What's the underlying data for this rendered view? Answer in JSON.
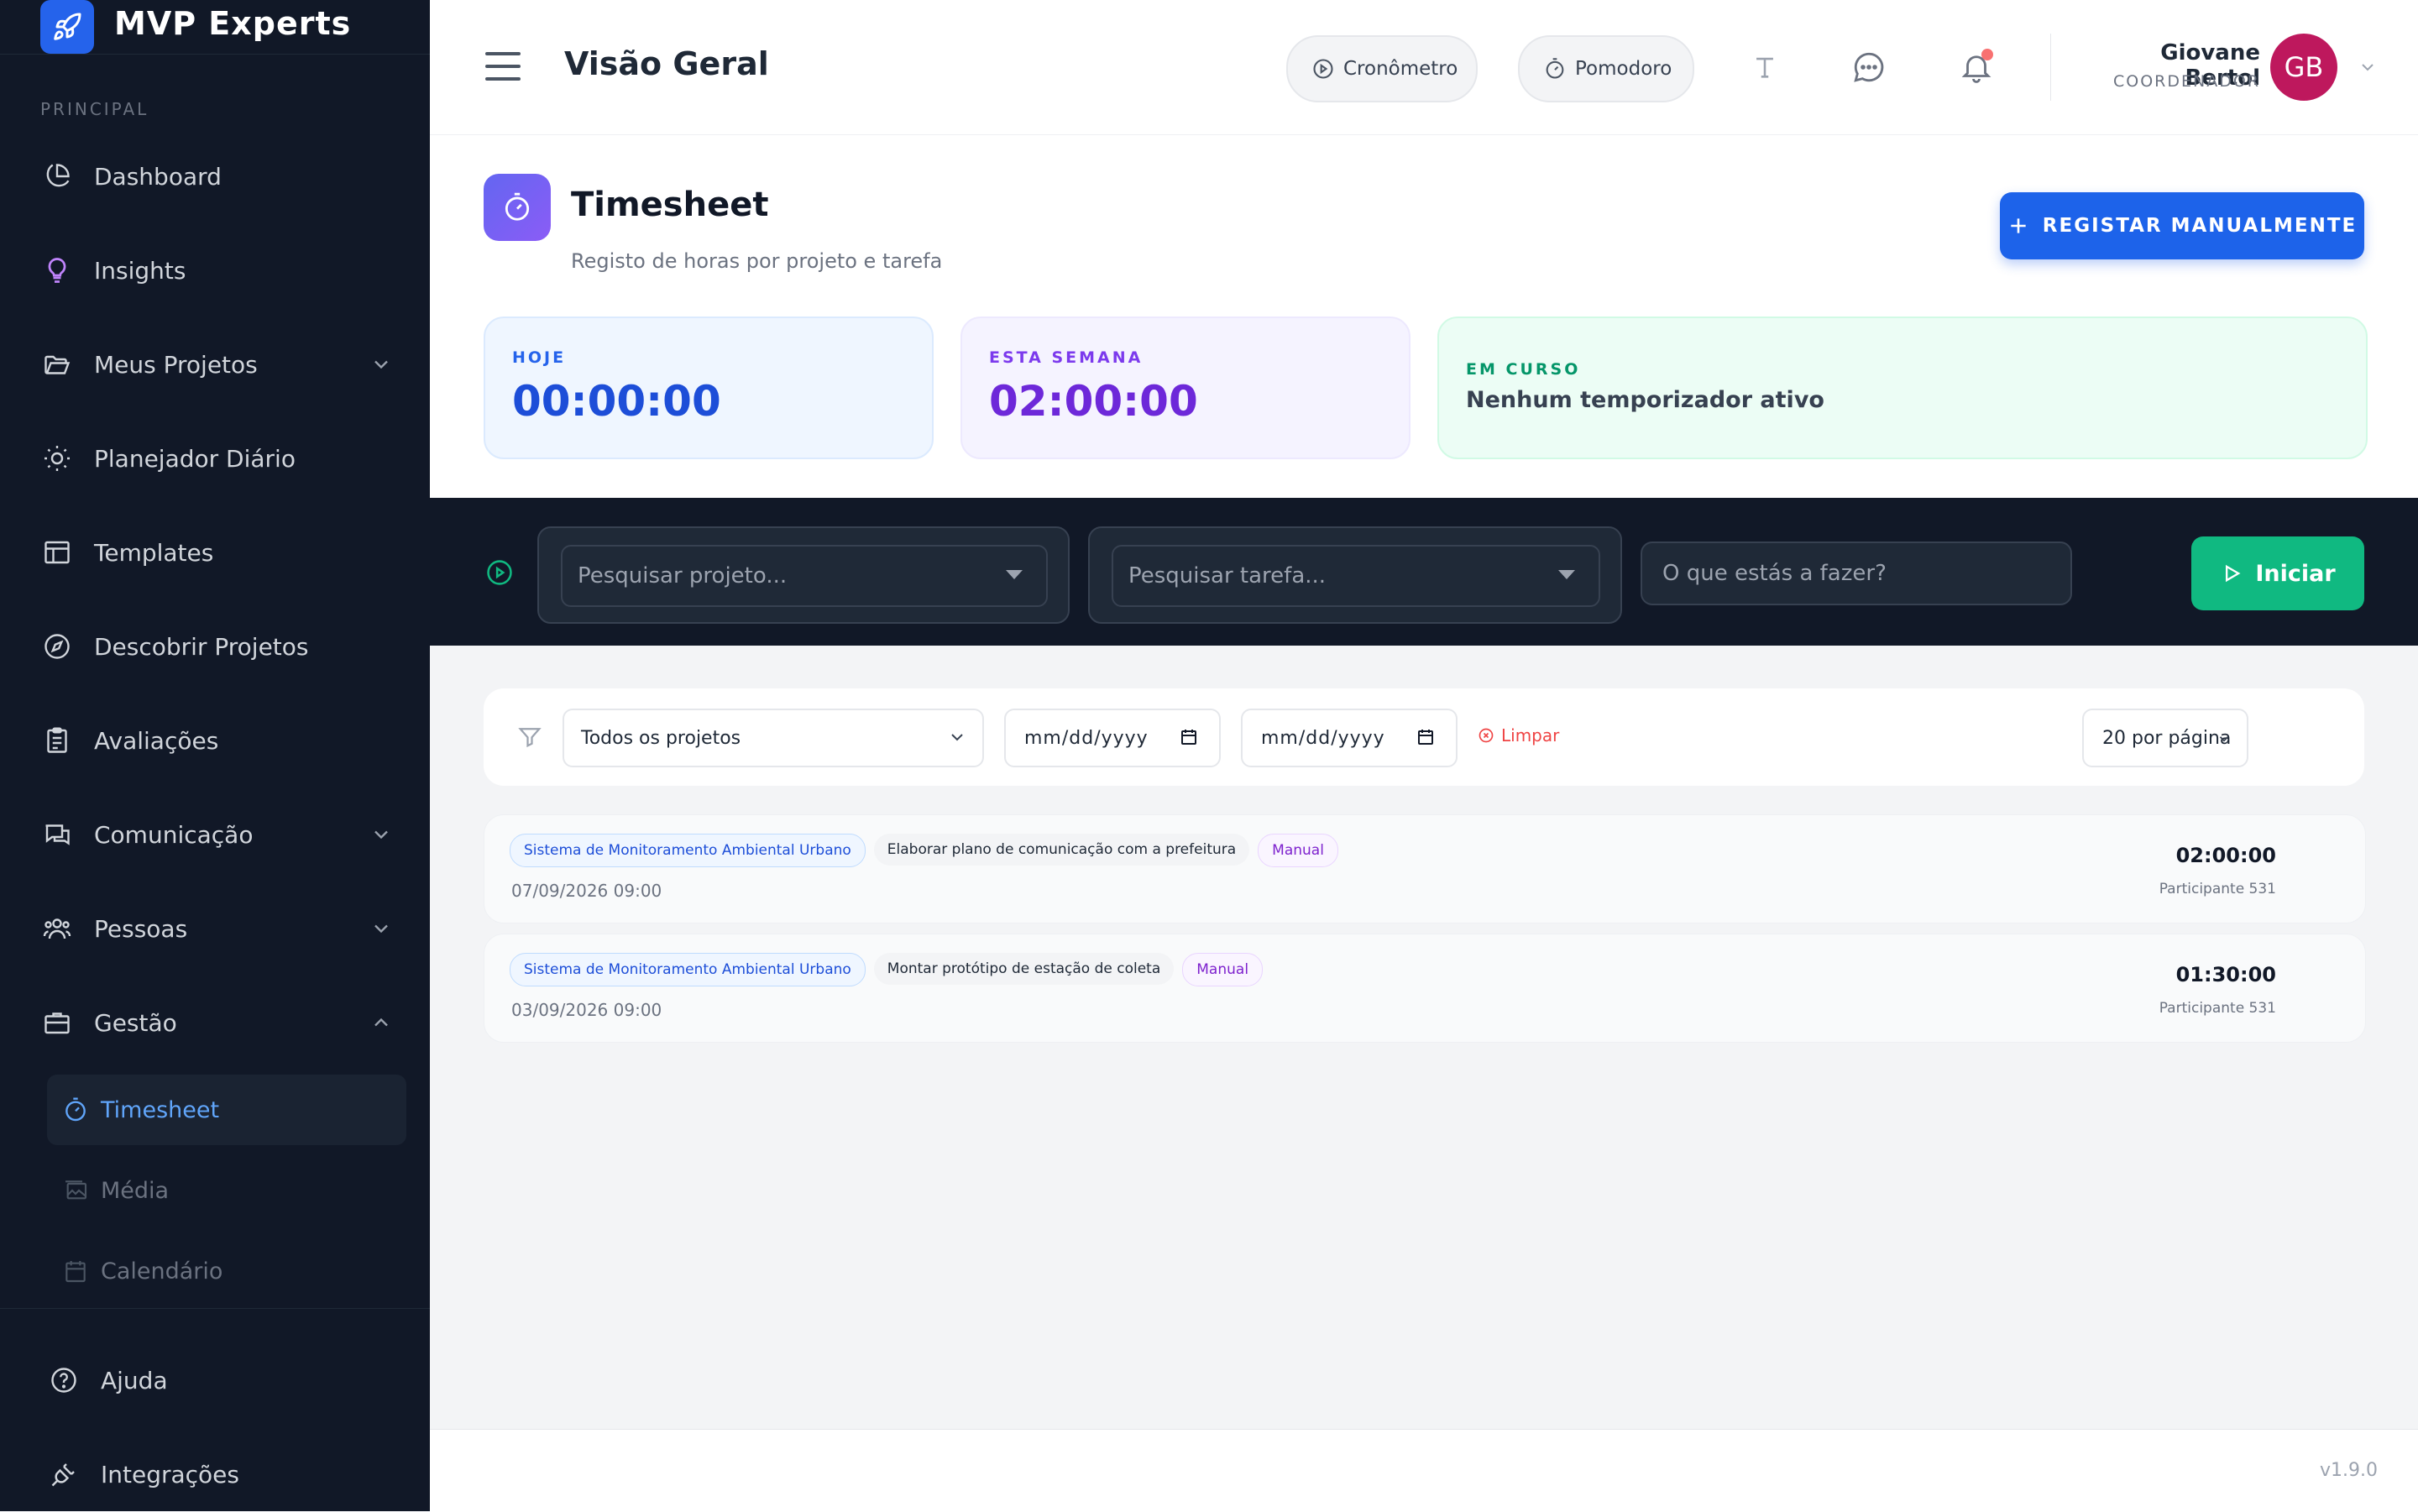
{
  "app": {
    "name": "MVP Experts"
  },
  "sidebar": {
    "section_label": "PRINCIPAL",
    "items": [
      {
        "label": "Dashboard",
        "icon": "pie-chart-icon"
      },
      {
        "label": "Insights",
        "icon": "lightbulb-icon"
      },
      {
        "label": "Meus Projetos",
        "icon": "folder-icon",
        "expandable": true
      },
      {
        "label": "Planejador Diário",
        "icon": "sun-icon"
      },
      {
        "label": "Templates",
        "icon": "layout-icon"
      },
      {
        "label": "Descobrir Projetos",
        "icon": "compass-icon"
      },
      {
        "label": "Avaliações",
        "icon": "clipboard-icon"
      },
      {
        "label": "Comunicação",
        "icon": "chat-icon",
        "expandable": true
      },
      {
        "label": "Pessoas",
        "icon": "users-icon",
        "expandable": true
      },
      {
        "label": "Gestão",
        "icon": "briefcase-icon",
        "expandable": true,
        "expanded": true
      }
    ],
    "sub_items": [
      {
        "label": "Timesheet",
        "icon": "stopwatch-icon",
        "active": true
      },
      {
        "label": "Média",
        "icon": "images-icon"
      },
      {
        "label": "Calendário",
        "icon": "calendar-icon"
      }
    ],
    "bottom": [
      {
        "label": "Ajuda",
        "icon": "help-icon"
      },
      {
        "label": "Integrações",
        "icon": "plug-icon"
      }
    ]
  },
  "header": {
    "title": "Visão Geral",
    "cronometro_label": "Cronômetro",
    "pomodoro_label": "Pomodoro",
    "user": {
      "name": "Giovane Bertol",
      "role": "COORDENADOR",
      "initials": "GB"
    }
  },
  "timesheet": {
    "title": "Timesheet",
    "subtitle": "Registo de horas por projeto e tarefa",
    "manual_button": "REGISTAR MANUALMENTE",
    "stats": {
      "today": {
        "label": "HOJE",
        "value": "00:00:00"
      },
      "week": {
        "label": "ESTA SEMANA",
        "value": "02:00:00"
      },
      "running": {
        "label": "EM CURSO",
        "value": "Nenhum temporizador ativo"
      }
    }
  },
  "timer": {
    "project_placeholder": "Pesquisar projeto...",
    "task_placeholder": "Pesquisar tarefa...",
    "doing_placeholder": "O que estás a fazer?",
    "start_label": "Iniciar"
  },
  "filters": {
    "project": "Todos os projetos",
    "date_from": "mm/dd/yyyy",
    "date_to": "mm/dd/yyyy",
    "clear": "Limpar",
    "per_page": "20 por página"
  },
  "entries": [
    {
      "project": "Sistema de Monitoramento Ambiental Urbano",
      "task": "Elaborar plano de comunicação com a prefeitura",
      "type": "Manual",
      "date": "07/09/2026 09:00",
      "duration": "02:00:00",
      "participant": "Participante 531"
    },
    {
      "project": "Sistema de Monitoramento Ambiental Urbano",
      "task": "Montar protótipo de estação de coleta",
      "type": "Manual",
      "date": "03/09/2026 09:00",
      "duration": "01:30:00",
      "participant": "Participante 531"
    }
  ],
  "footer": {
    "version": "v1.9.0"
  },
  "colors": {
    "sidebar_bg": "#111827",
    "primary": "#1d63ea",
    "success": "#10b981",
    "active_text": "#60a5fa",
    "avatar": "#be185d"
  }
}
